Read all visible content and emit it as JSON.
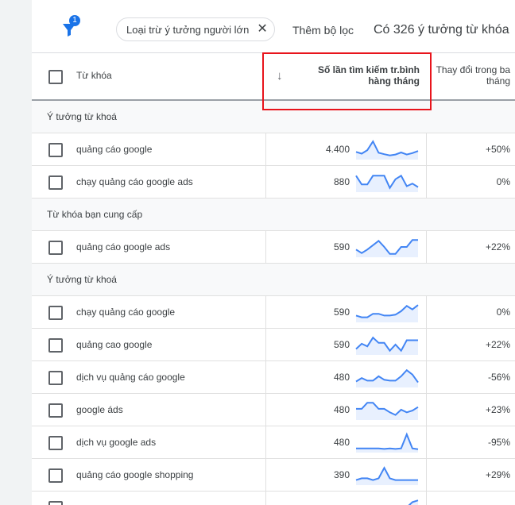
{
  "filter_bar": {
    "filter_badge_count": "1",
    "chip_label": "Loại trừ ý tưởng người lớn",
    "add_filter_label": "Thêm bộ lọc",
    "idea_count_text": "Có 326 ý tưởng từ khóa"
  },
  "table": {
    "col_keyword": "Từ khóa",
    "col_avg_searches": "Số lần tìm kiếm tr.bình hàng tháng",
    "col_change": "Thay đổi trong ba tháng"
  },
  "sections": [
    {
      "label": "Ý tưởng từ khoá",
      "rows": [
        {
          "keyword": "quảng cáo google",
          "volume": "4.400",
          "change": "+50%",
          "trend": [
            0.35,
            0.25,
            0.45,
            0.95,
            0.3,
            0.22,
            0.15,
            0.2,
            0.32,
            0.2,
            0.28,
            0.4
          ]
        },
        {
          "keyword": "chạy quảng cáo google ads",
          "volume": "880",
          "change": "0%",
          "trend": [
            0.85,
            0.35,
            0.35,
            0.85,
            0.85,
            0.85,
            0.15,
            0.65,
            0.85,
            0.25,
            0.4,
            0.2
          ]
        }
      ]
    },
    {
      "label": "Từ khóa bạn cung cấp",
      "rows": [
        {
          "keyword": "quảng cáo google ads",
          "volume": "590",
          "change": "+22%",
          "trend": [
            0.35,
            0.15,
            0.35,
            0.6,
            0.85,
            0.5,
            0.1,
            0.1,
            0.5,
            0.5,
            0.9,
            0.9
          ]
        }
      ]
    },
    {
      "label": "Ý tưởng từ khoá",
      "rows": [
        {
          "keyword": "chạy quảng cáo google",
          "volume": "590",
          "change": "0%",
          "trend": [
            0.3,
            0.2,
            0.2,
            0.4,
            0.4,
            0.3,
            0.3,
            0.35,
            0.55,
            0.85,
            0.65,
            0.9
          ]
        },
        {
          "keyword": "quảng cao google",
          "volume": "590",
          "change": "+22%",
          "trend": [
            0.25,
            0.55,
            0.4,
            0.9,
            0.6,
            0.6,
            0.15,
            0.5,
            0.15,
            0.75,
            0.75,
            0.75
          ]
        },
        {
          "keyword": "dịch vụ quảng cáo google",
          "volume": "480",
          "change": "-56%",
          "trend": [
            0.25,
            0.45,
            0.3,
            0.3,
            0.55,
            0.35,
            0.3,
            0.3,
            0.55,
            0.9,
            0.65,
            0.2
          ]
        },
        {
          "keyword": "google áds",
          "volume": "480",
          "change": "+23%",
          "trend": [
            0.55,
            0.55,
            0.9,
            0.9,
            0.55,
            0.55,
            0.35,
            0.2,
            0.5,
            0.35,
            0.45,
            0.65
          ]
        },
        {
          "keyword": "dịch vụ google ads",
          "volume": "480",
          "change": "-95%",
          "trend": [
            0.15,
            0.15,
            0.15,
            0.15,
            0.15,
            0.12,
            0.15,
            0.12,
            0.15,
            0.95,
            0.15,
            0.1
          ]
        },
        {
          "keyword": "quảng cáo google shopping",
          "volume": "390",
          "change": "+29%",
          "trend": [
            0.2,
            0.3,
            0.3,
            0.2,
            0.3,
            0.9,
            0.3,
            0.2,
            0.2,
            0.2,
            0.2,
            0.2
          ]
        },
        {
          "keyword": "",
          "volume": "",
          "change": "",
          "trend": [
            0.2,
            0.2,
            0.2,
            0.2,
            0.2,
            0.2,
            0.2,
            0.2,
            0.3,
            0.5,
            0.8,
            0.9
          ]
        }
      ]
    }
  ],
  "colors": {
    "sparkline": "#4285f4",
    "sparkline_fill": "#e8f0fe",
    "highlight": "#e8141c"
  },
  "icons": {
    "filter": "funnel-icon",
    "close": "close-icon",
    "sort": "arrow-down-icon",
    "checkbox": "checkbox-icon"
  }
}
